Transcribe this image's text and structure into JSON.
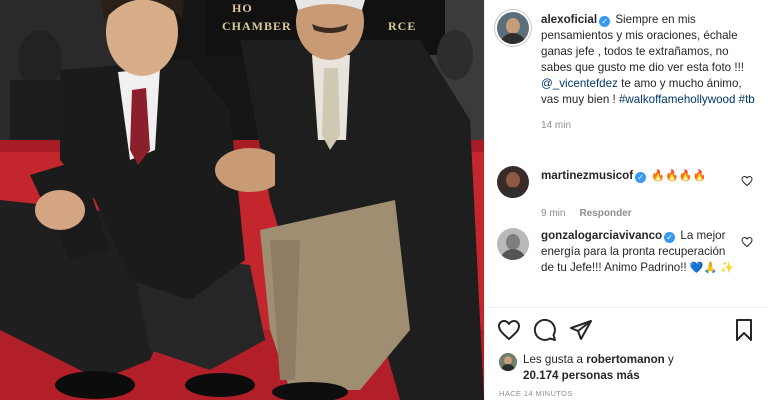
{
  "photo": {
    "sign_line1": "HO",
    "sign_line2": "CHAMBER",
    "sign_line3": "RCE"
  },
  "post": {
    "username": "alexoficial",
    "caption_text": "Siempre en mis pensamientos y mis oraciones, échale ganas jefe , todos te extrañamos, no sabes que gusto me dio ver esta foto !!!",
    "mention": "@_vicentefdez",
    "caption_tail": "te amo y mucho ánimo, vas muy bien !",
    "hashtags": "#walkoffamehollywood #tb",
    "time": "14 min"
  },
  "comments": [
    {
      "username": "martinezmusicof",
      "text": "🔥🔥🔥🔥",
      "time": "9 min",
      "reply_label": "Responder"
    },
    {
      "username": "gonzalogarciavivanco",
      "text": "La mejor energía para la pronta recuperación de tu Jefe!!! Animo Padrino!!",
      "emojis": "💙🙏 ✨"
    }
  ],
  "likes": {
    "prefix": "Les gusta a",
    "user": "robertomanon",
    "joiner": "y",
    "count_text": "20.174 personas más"
  },
  "timestamp": "HACE 14 MINUTOS",
  "icons": [
    "heart-icon",
    "comment-icon",
    "share-icon",
    "bookmark-icon",
    "verified-icon"
  ],
  "colors": {
    "verified": "#3897f0",
    "link": "#00376b",
    "muted": "#8e8e8e",
    "carpet": "#c4262e"
  }
}
